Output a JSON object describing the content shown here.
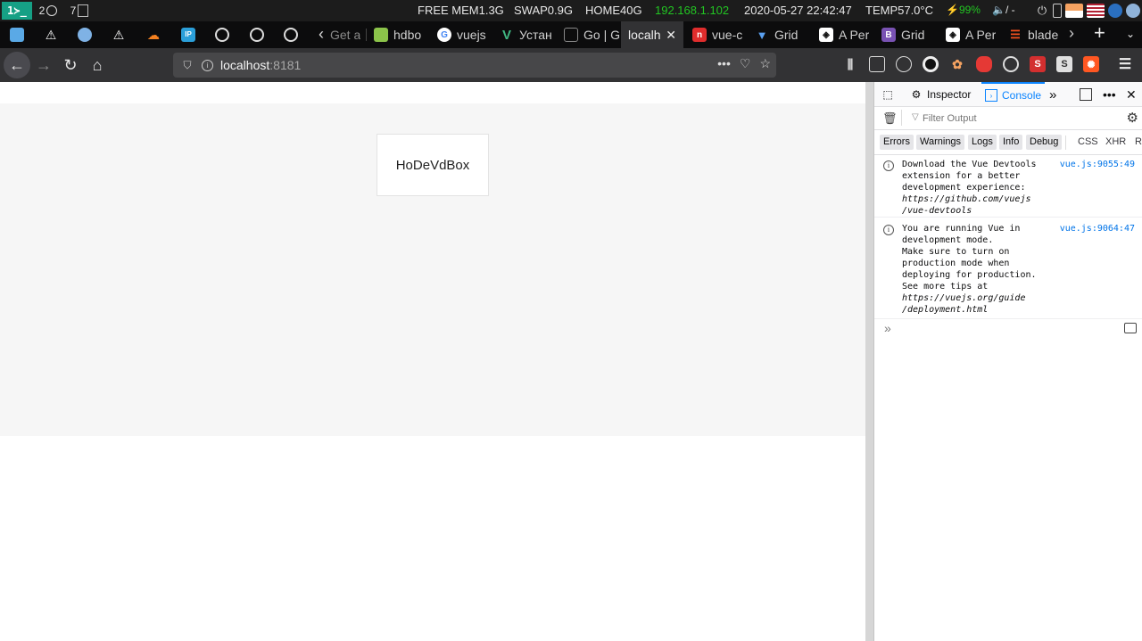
{
  "statusbar": {
    "ws1": "1≻_",
    "ws2": "2",
    "ws3": "7",
    "free_mem": "FREE MEM1.3G",
    "swap": "SWAP0.9G",
    "home": "HOME40G",
    "ip": "192.168.1.102",
    "datetime": "2020-05-27 22:42:47",
    "temp": "TEMP57.0°C",
    "battery": "⚡99%",
    "volume": "🔈/ -",
    "ip_color": "#22c522",
    "battery_color": "#22c522"
  },
  "tabs": [
    {
      "title": "Get a",
      "fav": "‹",
      "fav_color": "transparent"
    },
    {
      "title": "hdbo",
      "fav": "",
      "fav_color": "#8bc34a"
    },
    {
      "title": "vuejs",
      "fav": "G",
      "fav_color": "#4285f4"
    },
    {
      "title": "Устан",
      "fav": "V",
      "fav_color": "#41b883"
    },
    {
      "title": "Go | G",
      "fav": "▢",
      "fav_color": "#555555"
    },
    {
      "title": "localh",
      "fav": "",
      "fav_color": "transparent",
      "active": true
    },
    {
      "title": "vue-c",
      "fav": "n",
      "fav_color": "#e02d2d"
    },
    {
      "title": "Grid",
      "fav": "▼",
      "fav_color": "#1e88e5"
    },
    {
      "title": "A Per",
      "fav": "◈",
      "fav_color": "#333333"
    },
    {
      "title": "Grid",
      "fav": "B",
      "fav_color": "#7952b3"
    },
    {
      "title": "A Per",
      "fav": "◈",
      "fav_color": "#333333"
    },
    {
      "title": "blade",
      "fav": "☰",
      "fav_color": "#f4511e"
    }
  ],
  "tab_close": "✕",
  "new_tab": "+",
  "tab_overflow": "›",
  "nav": {
    "url_host": "localhost",
    "url_port": ":8181",
    "page_actions": "•••"
  },
  "page": {
    "box_text": "HoDeVdBox"
  },
  "devtools": {
    "tab_inspector": "Inspector",
    "tab_console": "Console",
    "filter_placeholder": "Filter Output",
    "levels": [
      "Errors",
      "Warnings",
      "Logs",
      "Info",
      "Debug"
    ],
    "extra_levels": [
      "CSS",
      "XHR",
      "R"
    ],
    "messages": [
      {
        "lines": "Download the Vue Devtools\nextension for a better\ndevelopment experience:",
        "link": "https://github.com/vuejs\n/vue-devtools",
        "source": "vue.js:9055:49"
      },
      {
        "lines": "You are running Vue in\ndevelopment mode.\nMake sure to turn on\nproduction mode when\ndeploying for production.\nSee more tips at",
        "link": "https://vuejs.org/guide\n/deployment.html",
        "source": "vue.js:9064:47"
      }
    ],
    "prompt_chevron": "»"
  }
}
